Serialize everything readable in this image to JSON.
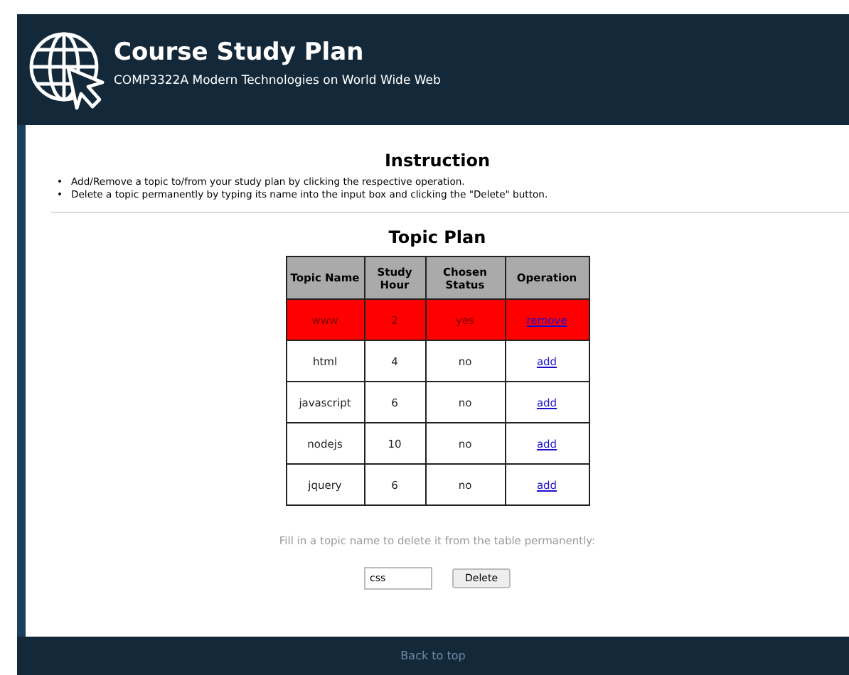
{
  "header": {
    "title": "Course Study Plan",
    "subtitle": "COMP3322A Modern Technologies on World Wide Web"
  },
  "instruction": {
    "heading": "Instruction",
    "bullet": "•",
    "items": [
      "Add/Remove a topic to/from your study plan by clicking the respective operation.",
      "Delete a topic permanently by typing its name into the input box and clicking the \"Delete\" button."
    ]
  },
  "topic_plan": {
    "heading": "Topic Plan",
    "columns": [
      "Topic Name",
      "Study Hour",
      "Chosen Status",
      "Operation"
    ],
    "rows": [
      {
        "name": "www",
        "hour": "2",
        "status": "yes",
        "operation": "remove",
        "selected": true
      },
      {
        "name": "html",
        "hour": "4",
        "status": "no",
        "operation": "add",
        "selected": false
      },
      {
        "name": "javascript",
        "hour": "6",
        "status": "no",
        "operation": "add",
        "selected": false
      },
      {
        "name": "nodejs",
        "hour": "10",
        "status": "no",
        "operation": "add",
        "selected": false
      },
      {
        "name": "jquery",
        "hour": "6",
        "status": "no",
        "operation": "add",
        "selected": false
      }
    ]
  },
  "delete_form": {
    "prompt": "Fill in a topic name to delete it from the table permanently:",
    "value": "css",
    "button": "Delete"
  },
  "footer": {
    "link": "Back to top"
  }
}
